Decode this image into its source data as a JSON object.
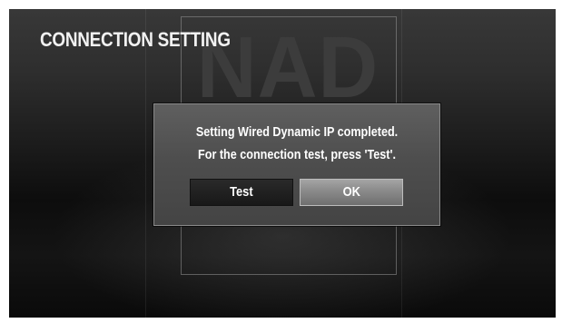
{
  "screen": {
    "title": "CONNECTION SETTING",
    "brand_logo": "NAD"
  },
  "dialog": {
    "message_lines": [
      "Setting Wired Dynamic IP completed.",
      "For the connection test, press 'Test'."
    ],
    "buttons": {
      "test_label": "Test",
      "ok_label": "OK",
      "focused": "OK"
    }
  },
  "colors": {
    "background": "#0d0d0d",
    "dialog": "#4e4e4e",
    "focused_button": "#8a8a8a",
    "text": "#ffffff"
  }
}
